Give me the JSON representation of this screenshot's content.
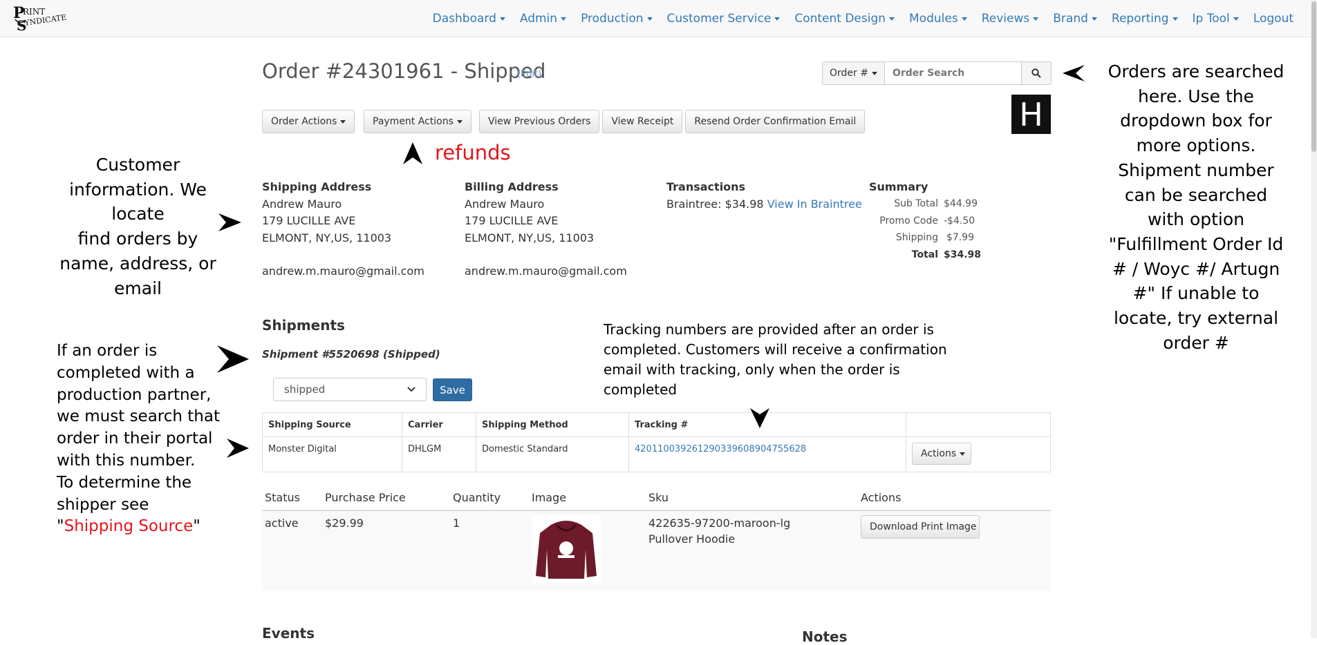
{
  "brand": {
    "logo_text": "Print Syndicate"
  },
  "nav": {
    "items": [
      {
        "label": "Dashboard",
        "dropdown": true
      },
      {
        "label": "Admin",
        "dropdown": true
      },
      {
        "label": "Production",
        "dropdown": true
      },
      {
        "label": "Customer Service",
        "dropdown": true
      },
      {
        "label": "Content Design",
        "dropdown": true
      },
      {
        "label": "Modules",
        "dropdown": true
      },
      {
        "label": "Reviews",
        "dropdown": true
      },
      {
        "label": "Brand",
        "dropdown": true
      },
      {
        "label": "Reporting",
        "dropdown": true
      },
      {
        "label": "Ip Tool",
        "dropdown": true
      },
      {
        "label": "Logout",
        "dropdown": false
      }
    ],
    "link_color": "#337ab7"
  },
  "order": {
    "title": "Order #24301961 - Shipped",
    "edit_label": "(Edit)"
  },
  "search": {
    "type_label": "Order #",
    "placeholder": "Order Search"
  },
  "toolbar": {
    "order_actions": "Order Actions",
    "payment_actions": "Payment Actions",
    "view_previous_orders": "View Previous Orders",
    "view_receipt": "View Receipt",
    "resend_confirmation": "Resend Order Confirmation Email"
  },
  "h_icon": {
    "letter": "H"
  },
  "shipping": {
    "heading": "Shipping Address",
    "name": "Andrew Mauro",
    "street": "179 LUCILLE AVE",
    "city": "ELMONT, NY,US, 11003",
    "email": "andrew.m.mauro@gmail.com"
  },
  "billing": {
    "heading": "Billing Address",
    "name": "Andrew Mauro",
    "street": "179 LUCILLE AVE",
    "city": "ELMONT, NY,US, 11003",
    "email": "andrew.m.mauro@gmail.com"
  },
  "transactions": {
    "heading": "Transactions",
    "entry": "Braintree: $34.98",
    "link": "View In Braintree"
  },
  "summary": {
    "heading": "Summary",
    "rows": [
      {
        "label": "Sub Total",
        "value": "$44.99"
      },
      {
        "label": "Promo Code",
        "value": "-$4.50"
      },
      {
        "label": "Shipping",
        "value": "$7.99"
      },
      {
        "label": "Total",
        "value": "$34.98"
      }
    ]
  },
  "shipments": {
    "heading": "Shipments",
    "shipment_label": "Shipment #5520698 (Shipped)",
    "status_value": "shipped",
    "save_label": "Save",
    "columns": [
      "Shipping Source",
      "Carrier",
      "Shipping Method",
      "Tracking #",
      ""
    ],
    "row": {
      "source": "Monster Digital",
      "carrier": "DHLGM",
      "method": "Domestic Standard",
      "tracking": "420110039261290339608904755628",
      "actions": "Actions"
    }
  },
  "items": {
    "columns": [
      "Status",
      "Purchase Price",
      "Quantity",
      "Image",
      "Sku",
      "Actions"
    ],
    "row": {
      "status": "active",
      "price": "$29.99",
      "quantity": "1",
      "sku_line1": "422635-97200-maroon-lg",
      "sku_line2": "Pullover Hoodie",
      "action": "Download Print Image"
    }
  },
  "sections": {
    "events": "Events",
    "notes": "Notes"
  },
  "annotations": {
    "refunds": "refunds",
    "customer_info": [
      "Customer",
      "information. We",
      "locate",
      "find orders by",
      "name, address, or",
      "email"
    ],
    "search_help": [
      "Orders are searched",
      "here. Use the",
      "dropdown box for",
      "more options.",
      "Shipment number",
      "can be searched",
      "with option",
      "\"Fulfillment Order Id",
      "# / Woyc #/ Artugn",
      "#\"  If unable to",
      "locate, try external",
      "order #"
    ],
    "partner_help": [
      "If an order is",
      "completed with a",
      "production partner,",
      "we must search that",
      "order in their portal",
      "with this number.",
      "To determine the",
      "shipper see"
    ],
    "partner_quote_open": "\"",
    "partner_source": "Shipping Source",
    "partner_quote_close": "\"",
    "tracking_help": [
      "Tracking numbers are provided after an order is",
      "completed. Customers will receive a confirmation",
      "email with tracking, only when the order is",
      "completed"
    ],
    "highlight_color": "#e3151a"
  }
}
